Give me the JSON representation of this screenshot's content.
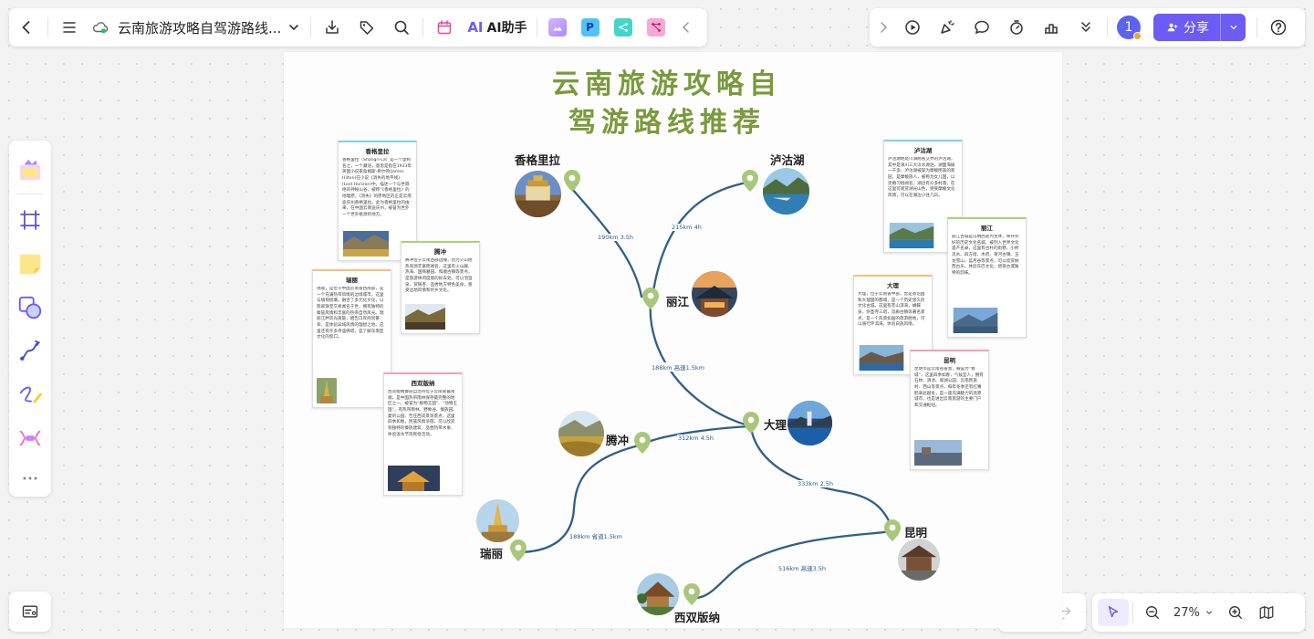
{
  "toolbar": {
    "doc_title": "云南旅游攻略自驾游路线...",
    "ai_label": "AI助手",
    "ai_logo": "AI",
    "app_p": "P"
  },
  "toolbar_right": {
    "avatar_count": "1",
    "share_label": "分享"
  },
  "zoom": {
    "value": "27%"
  },
  "colors": {
    "accent": "#6c5cf5",
    "title_green": "#7a9a3c",
    "route_blue": "#2f5f8a",
    "pin_green": "#a9c77a"
  },
  "mindmap": {
    "title_line1": "云南旅游攻略自",
    "title_line2": "驾游路线推荐",
    "places": {
      "shangrila": "香格里拉",
      "lugu": "泸沽湖",
      "lijiang": "丽江",
      "dali": "大理",
      "tengchong": "腾冲",
      "ruili": "瑞丽",
      "kunming": "昆明",
      "xishuangbanna": "西双版纳"
    },
    "distances": {
      "shangrila_lijiang": "190km 3.5h",
      "lugu_lijiang": "215km 4h",
      "lijiang_dali": "188km 高速1.5km",
      "dali_tengchong": "312km 4.5h",
      "tengchong_ruili": "188km 省道1.5km",
      "dali_kunming": "333km 2.5h",
      "kunming_banna": "516km 高速3.5h"
    },
    "cards": {
      "shangrila": {
        "title": "香格里拉",
        "body": "香格里拉（Shangri-La）是一个虚构名之，一个藏语，意思是指在1933年英国小说家詹姆斯·希尔顿(James Hilton)在小说《消失的地平线》(Lost Horizon)中，描述一个与世隔绝的神秘山谷，被称“《香格里拉》的地理原，《消失》的原地区的正是云南迪庆州香格里拉。此为香格里拉的由来，在中国云南迪庆州，被誉为世外一个世外桃源的地方。"
      },
      "lugu": {
        "title": "泸沽湖",
        "body": "泸沽湖地处川滇两省交界的泸沽湖，其中是滇川三大淡水湖泊，湖面海拔一千多，泸沽湖被誉为摩梭民族的家园，是摩梭族人，被称为女儿国，以走婚习俗闻名，湖边有众多村落，在这里可观赏湖光山色，感受摩梭文化风情，可以在湖边小住几日。"
      },
      "tengchong": {
        "title": "腾冲",
        "body": "腾冲位于云南西部边陲，因为火山地热资源丰富而闻名，这里有火山群、热海、国殇墓园、和顺古镇等景点，是旅游休闲度假的好去处，可以泡温泉、赏银杏、品尝地方特色美食，感受边地风情和侨乡文化。"
      },
      "ruili": {
        "title": "瑞丽",
        "body": "瑞丽，是位于中国云南省西南部，是一个充满热带风情的边境城市。这里与缅甸接壤，融合了多元化文化，以翡翠珠宝交易闻名于世，拥有独特的傣族风情和丰富的热带自然风光。瑞丽江畔风光旖旎，姐告口岸商贸繁荣，是体验异域风情的理想之地。这里还有许多寺庙佛塔，是了解东南亚文化的窗口。"
      },
      "xishuangbanna": {
        "title": "西双版纳",
        "body": "西双版纳傣族自治州位于云南省最南端，是中国热带雨林保存最完整的地区之一，被誉为“植物王国”、“动物王国”，有热带雨林、野象谷、傣族园、曼听公园、告庄西双景等景点，这里四季如春，民族风情浓郁，可以欣赏到独特的傣族建筑、品尝热带水果、体验泼水节等民俗活动。"
      },
      "lijiang": {
        "title": "丽江",
        "body": "丽江古城是以纳西族为主体，保存完好的历史文化名城，被列入世界文化遗产名录，这里有古朴的街巷、小桥流水、四方街、木府、束河古镇、玉龙雪山、蓝月谷等景点，可以欣赏纳西古乐，体验东巴文化，感受古城独特的韵味。"
      },
      "dali": {
        "title": "大理",
        "body": "大理，位于云南省中部，曾是南诏国和大理国的都城，是一个历史悠久的文化古城。这里有苍山洱海，蝴蝶泉，崇圣寺三塔，双廊古镇等著名景点，是一个风景如画的旅游胜地，可以骑行环洱海，体验白族风情。"
      },
      "kunming": {
        "title": "昆明",
        "body": "昆明市是云南省省会，被誉为“春城”，这里四季如春，气候宜人，拥有石林、滇池、翠湖公园、云南民族村、西山等景点，每年冬季还有红嘴鸥来此越冬，是一座充满魅力的高原城市，也是进出云南旅游的主要门户和交通枢纽。"
      }
    }
  }
}
